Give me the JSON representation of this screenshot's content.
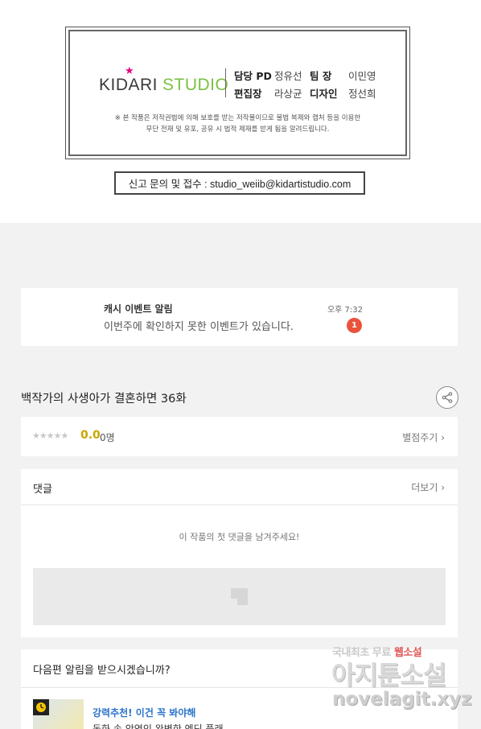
{
  "credits": {
    "logo_main": "KIDARI",
    "logo_sub": "STUDIO",
    "rows": [
      [
        "담당 PD",
        "정유선",
        "팀 장",
        "이민영"
      ],
      [
        "편집장",
        "라상균",
        "디자인",
        "정선희"
      ]
    ],
    "notice_line1": "※ 본 작품은 저작권법에 의해 보호를 받는 저작물이므로 불법 복제와 캡처 등을 이용한",
    "notice_line2": "무단 전재 및 유포, 공유 시 법적 제재를 받게 됨을 알려드립니다."
  },
  "report": {
    "text": "신고 문의 및 접수 : studio_weiib@kidartistudio.com"
  },
  "notification": {
    "title": "캐시 이벤트 알림",
    "body": "이번주에 확인하지 못한 이벤트가 있습니다.",
    "time": "오후 7:32",
    "badge": "1"
  },
  "episode": {
    "title": "백작가의 사생아가 결혼하면 36화",
    "share_icon": "share-icon"
  },
  "rating": {
    "stars": "★★★★★",
    "score": "0.0",
    "count": "0명",
    "rate_label": "별점주기",
    "chevron": "›"
  },
  "comments": {
    "title": "댓글",
    "more_label": "더보기",
    "chevron": "›",
    "empty_message": "이 작품의 첫 댓글을 남겨주세요!"
  },
  "next_alert": {
    "question": "다음편 알림을 받으시겠습니까?",
    "rec_title": "강력추천! 이건 꼭 봐야해",
    "rec_desc": "동화 속 악역인 완벽한 엔딩 플래"
  },
  "watermark": {
    "line1_a": "국내최초 무료",
    "line1_b": "웹소설",
    "line2": "아지툰소설",
    "line3": "novelagit.xyz"
  },
  "colors": {
    "accent_green": "#7ac143",
    "badge_red": "#e9533c",
    "score_gold": "#c9a500",
    "link_blue": "#2a73c9"
  }
}
